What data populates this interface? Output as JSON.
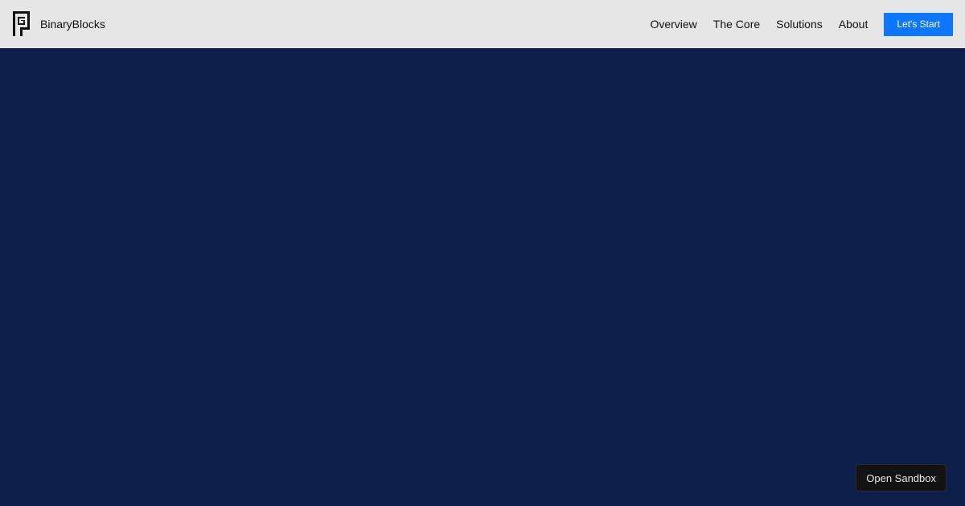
{
  "header": {
    "brand_name": "BinaryBlocks",
    "logo_icon": "spiral-square-logo-icon",
    "nav": [
      {
        "label": "Overview"
      },
      {
        "label": "The Core"
      },
      {
        "label": "Solutions"
      },
      {
        "label": "About"
      }
    ],
    "cta_label": "Let's Start"
  },
  "floating": {
    "sandbox_label": "Open Sandbox"
  },
  "colors": {
    "header_bg": "#e6e6e6",
    "hero_bg": "#0d1e4b",
    "accent": "#0d76ff",
    "sandbox_bg": "#131313"
  }
}
